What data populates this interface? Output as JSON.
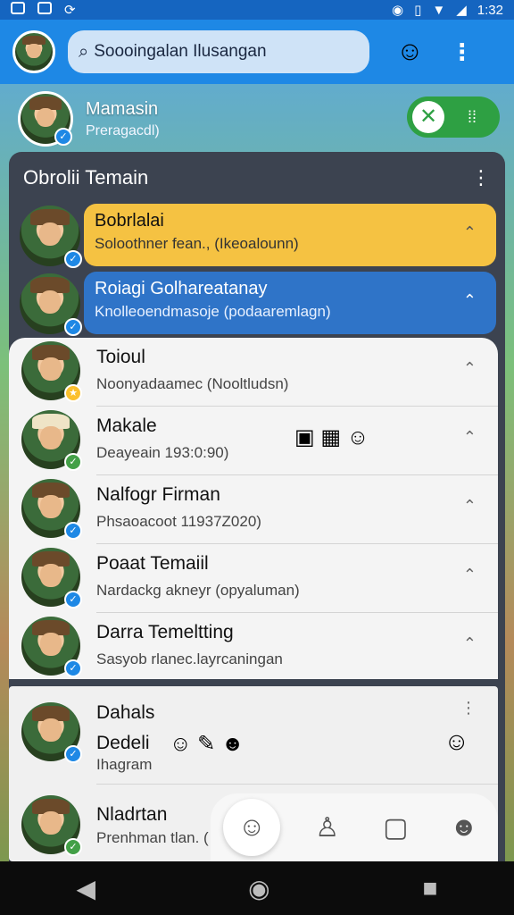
{
  "status_bar": {
    "time": "1:32"
  },
  "search": {
    "placeholder": "Soooingalan Ilusangan"
  },
  "profile": {
    "name": "Mamasin",
    "status": "Preragacdl)"
  },
  "panel": {
    "title": "Obrolii Temain"
  },
  "chats": [
    {
      "title": "Bobrlalai",
      "subtitle": "Soloothner fean., (Ikeoalounn)",
      "style": "yellow"
    },
    {
      "title": "Roiagi Golhareatanay",
      "subtitle": "Knolleoendmasoje (podaaremlagn)",
      "style": "blue"
    }
  ],
  "rows": [
    {
      "title": "Toioul",
      "subtitle": "Noonyadaamec (Nooltludsn)"
    },
    {
      "title": "Makale",
      "subtitle": "Deayeain 193:0:90)"
    },
    {
      "title": "Nalfogr Firman",
      "subtitle": "Phsaoacoot 11937Z020)"
    },
    {
      "title": "Poaat Temaiil",
      "subtitle": "Nardackg akneyr (opyaluman)"
    },
    {
      "title": "Darra Temeltting",
      "subtitle": "Sasyob rlanec.layrcaningan"
    }
  ],
  "lower_rows": [
    {
      "title": "Dahals",
      "subtitle": "Dedeli",
      "subtitle2": "Ihagram"
    },
    {
      "title": "Nladrtan",
      "subtitle": "Prenhman tlan. ("
    }
  ],
  "colors": {
    "appbar": "#1e88e5",
    "accent_yellow": "#f5c242",
    "accent_blue": "#2f74c8",
    "toggle": "#2ea043"
  }
}
